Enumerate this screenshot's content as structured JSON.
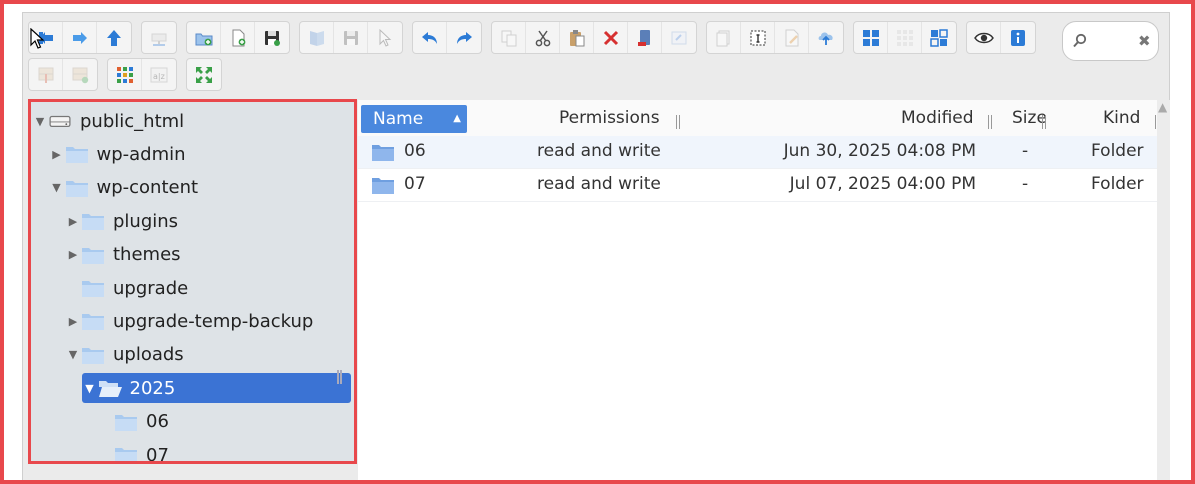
{
  "toolbar": {
    "row1": [
      [
        "back-icon",
        "forward-icon",
        "up-icon"
      ],
      [
        "mount-drive-icon"
      ],
      [
        "new-folder-icon",
        "new-file-icon",
        "save-icon"
      ],
      [
        "open-icon",
        "save-disabled-icon",
        "select-icon"
      ],
      [
        "undo-icon",
        "redo-icon"
      ],
      [
        "copy-icon",
        "cut-icon",
        "paste-icon",
        "delete-icon",
        "empty-trash-icon",
        "rename-icon"
      ],
      [
        "duplicate-icon",
        "info-frame-icon",
        "edit-icon",
        "upload-icon"
      ],
      [
        "view-icons-icon",
        "view-small-icons-icon",
        "view-tiles-icon"
      ],
      [
        "preview-icon",
        "info-icon"
      ]
    ],
    "row2": [
      [
        "extract-icon",
        "archive-icon"
      ],
      [
        "grid-view-icon",
        "sort-az-icon"
      ],
      [
        "fullscreen-icon"
      ]
    ]
  },
  "search": {
    "value": "",
    "placeholder": "",
    "clear_label": "✖"
  },
  "tree": {
    "nodes": [
      {
        "label": "public_html",
        "level": 0,
        "arrow": "▼",
        "type": "drive"
      },
      {
        "label": "wp-admin",
        "level": 1,
        "arrow": "▶",
        "type": "folder"
      },
      {
        "label": "wp-content",
        "level": 1,
        "arrow": "▼",
        "type": "folder"
      },
      {
        "label": "plugins",
        "level": 2,
        "arrow": "▶",
        "type": "folder"
      },
      {
        "label": "themes",
        "level": 2,
        "arrow": "▶",
        "type": "folder"
      },
      {
        "label": "upgrade",
        "level": 2,
        "arrow": "",
        "type": "folder"
      },
      {
        "label": "upgrade-temp-backup",
        "level": 2,
        "arrow": "▶",
        "type": "folder"
      },
      {
        "label": "uploads",
        "level": 2,
        "arrow": "▼",
        "type": "folder"
      },
      {
        "label": "2025",
        "level": 3,
        "arrow": "▼",
        "type": "folder-open",
        "selected": true
      },
      {
        "label": "06",
        "level": 4,
        "arrow": "",
        "type": "folder"
      },
      {
        "label": "07",
        "level": 4,
        "arrow": "",
        "type": "folder"
      }
    ]
  },
  "list": {
    "columns": {
      "name": "Name",
      "permissions": "Permissions",
      "modified": "Modified",
      "size": "Size",
      "kind": "Kind"
    },
    "sort_arrow": "▲",
    "rows": [
      {
        "name": "06",
        "permissions": "read and write",
        "modified": "Jun 30, 2025 04:08 PM",
        "size": "-",
        "kind": "Folder"
      },
      {
        "name": "07",
        "permissions": "read and write",
        "modified": "Jul 07, 2025 04:00 PM",
        "size": "-",
        "kind": "Folder"
      }
    ]
  },
  "colors": {
    "accent": "#3b73d4",
    "highlight": "#e8484c",
    "folder": "#8db8ec"
  }
}
